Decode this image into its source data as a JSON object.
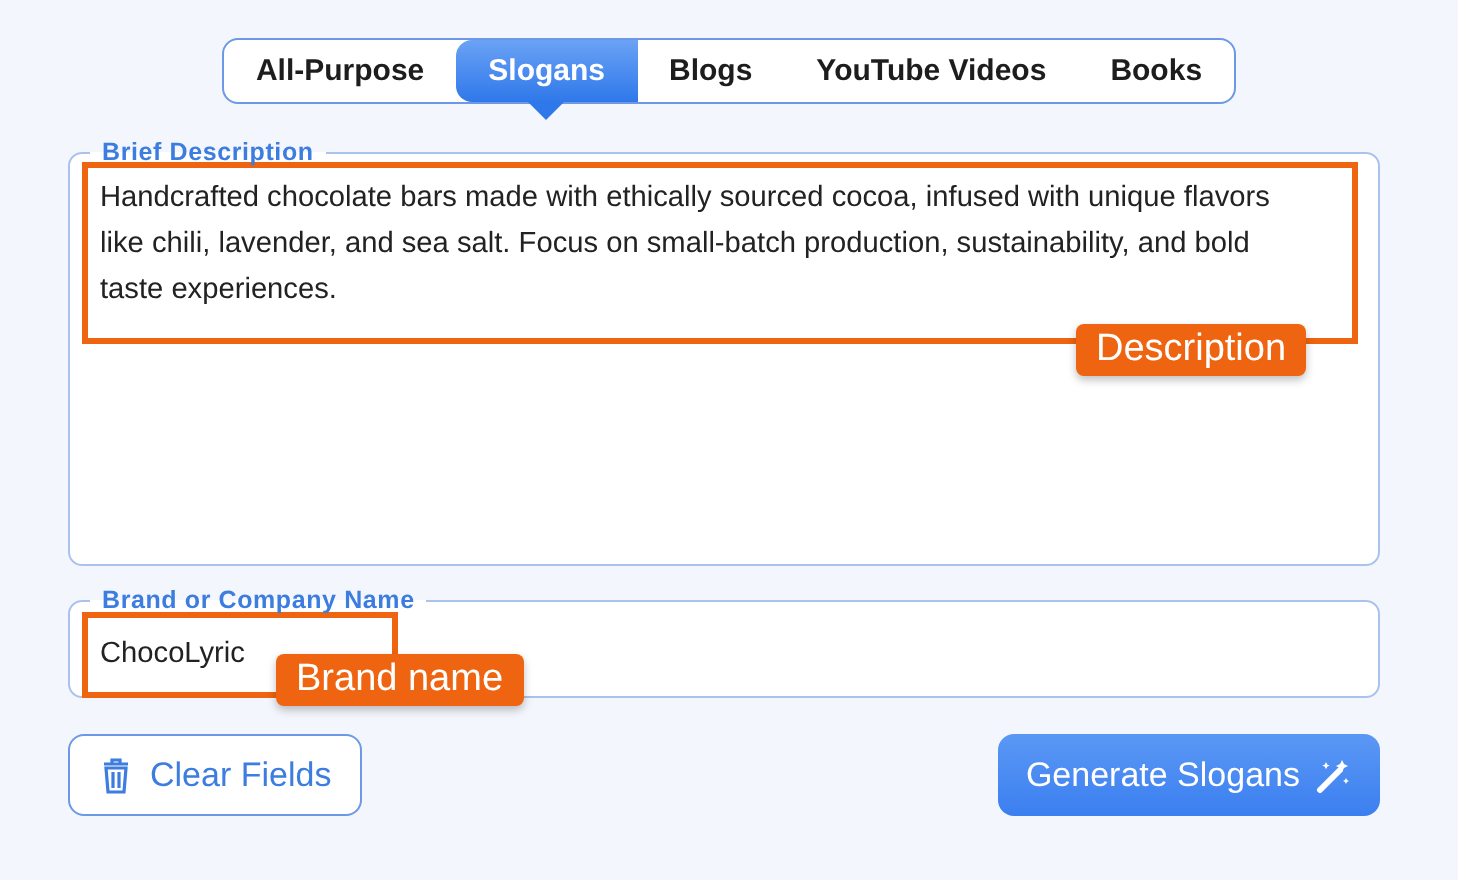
{
  "tabs": [
    {
      "label": "All-Purpose",
      "selected": false
    },
    {
      "label": "Slogans",
      "selected": true
    },
    {
      "label": "Blogs",
      "selected": false
    },
    {
      "label": "YouTube Videos",
      "selected": false
    },
    {
      "label": "Books",
      "selected": false
    }
  ],
  "description": {
    "legend": "Brief Description",
    "value": "Handcrafted chocolate bars made with ethically sourced cocoa, infused with unique flavors like chili, lavender, and sea salt. Focus on small-batch production, sustainability, and bold taste experiences.",
    "callout": "Description"
  },
  "brand": {
    "legend": "Brand or Company Name",
    "value": "ChocoLyric",
    "callout": "Brand name"
  },
  "buttons": {
    "clear": "Clear Fields",
    "generate": "Generate Slogans"
  }
}
